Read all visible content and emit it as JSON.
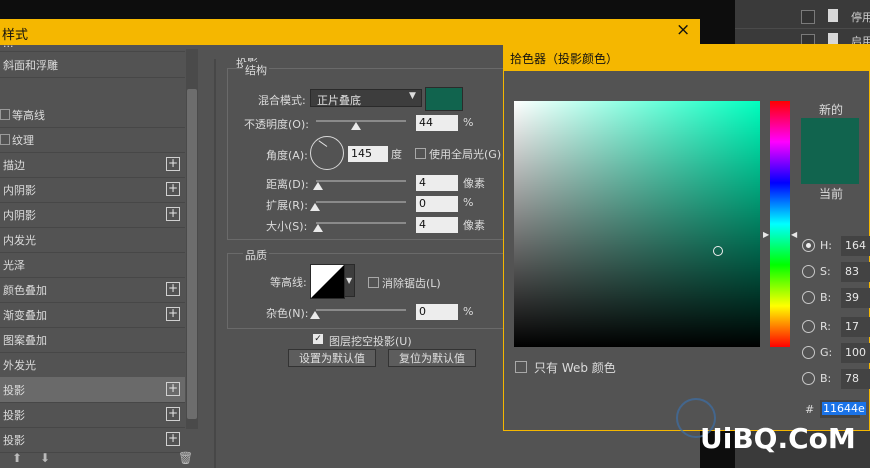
{
  "background_panel": {
    "rows": [
      {
        "label": "停用"
      },
      {
        "label": "启用"
      }
    ]
  },
  "style_dialog": {
    "title": "样式",
    "close_glyph": "×",
    "list_items": [
      {
        "label": "等高线",
        "checkbox": true
      },
      {
        "label": "纹理",
        "checkbox": true
      },
      {
        "label": "描边",
        "plus": "+"
      },
      {
        "label": "内阴影",
        "plus": "+"
      },
      {
        "label": "内阴影",
        "plus": "+"
      },
      {
        "label": "内发光"
      },
      {
        "label": "光泽"
      },
      {
        "label": "颜色叠加",
        "plus": "+"
      },
      {
        "label": "渐变叠加",
        "plus": "+"
      },
      {
        "label": "图案叠加"
      },
      {
        "label": "外发光"
      },
      {
        "label": "投影",
        "plus": "+",
        "active": true
      },
      {
        "label": "投影",
        "plus": "+"
      },
      {
        "label": "投影",
        "plus": "+"
      }
    ],
    "list_top_items": {
      "partial": "...",
      "bevel": "斜面和浮雕"
    },
    "section_title": "投影",
    "structure": {
      "label": "结构",
      "blend_mode_label": "混合模式:",
      "blend_mode_value": "正片叠底",
      "swatch_color": "#11644e",
      "opacity_label": "不透明度(O):",
      "opacity_value": "44",
      "opacity_unit": "%",
      "opacity_level": 0.44,
      "angle_label": "角度(A):",
      "angle_value": "145",
      "angle_unit": "度",
      "global_light_label": "使用全局光(G)",
      "distance_label": "距离(D):",
      "distance_value": "4",
      "distance_unit": "像素",
      "spread_label": "扩展(R):",
      "spread_value": "0",
      "spread_unit": "%",
      "size_label": "大小(S):",
      "size_value": "4",
      "size_unit": "像素"
    },
    "quality": {
      "label": "品质",
      "contour_label": "等高线:",
      "antialias_label": "消除锯齿(L)",
      "noise_label": "杂色(N):",
      "noise_value": "0",
      "noise_unit": "%"
    },
    "knockout_label": "图层挖空投影(U)",
    "knockout_checked": true,
    "set_default_label": "设置为默认值",
    "reset_default_label": "复位为默认值"
  },
  "color_picker": {
    "title": "拾色器（投影颜色）",
    "new_label": "新的",
    "current_label": "当前",
    "new_color": "#11644e",
    "current_color": "#11644e",
    "web_only_label": "只有 Web 颜色",
    "hsb": [
      {
        "label": "H:",
        "value": "164",
        "selected": true
      },
      {
        "label": "S:",
        "value": "83"
      },
      {
        "label": "B:",
        "value": "39"
      }
    ],
    "rgb": [
      {
        "label": "R:",
        "value": "17"
      },
      {
        "label": "G:",
        "value": "100"
      },
      {
        "label": "B:",
        "value": "78"
      }
    ],
    "hex_label": "#",
    "hex_value": "11644e",
    "hue_color": "#00ffbf"
  },
  "watermark": {
    "text": "UiBQ.CoM"
  }
}
